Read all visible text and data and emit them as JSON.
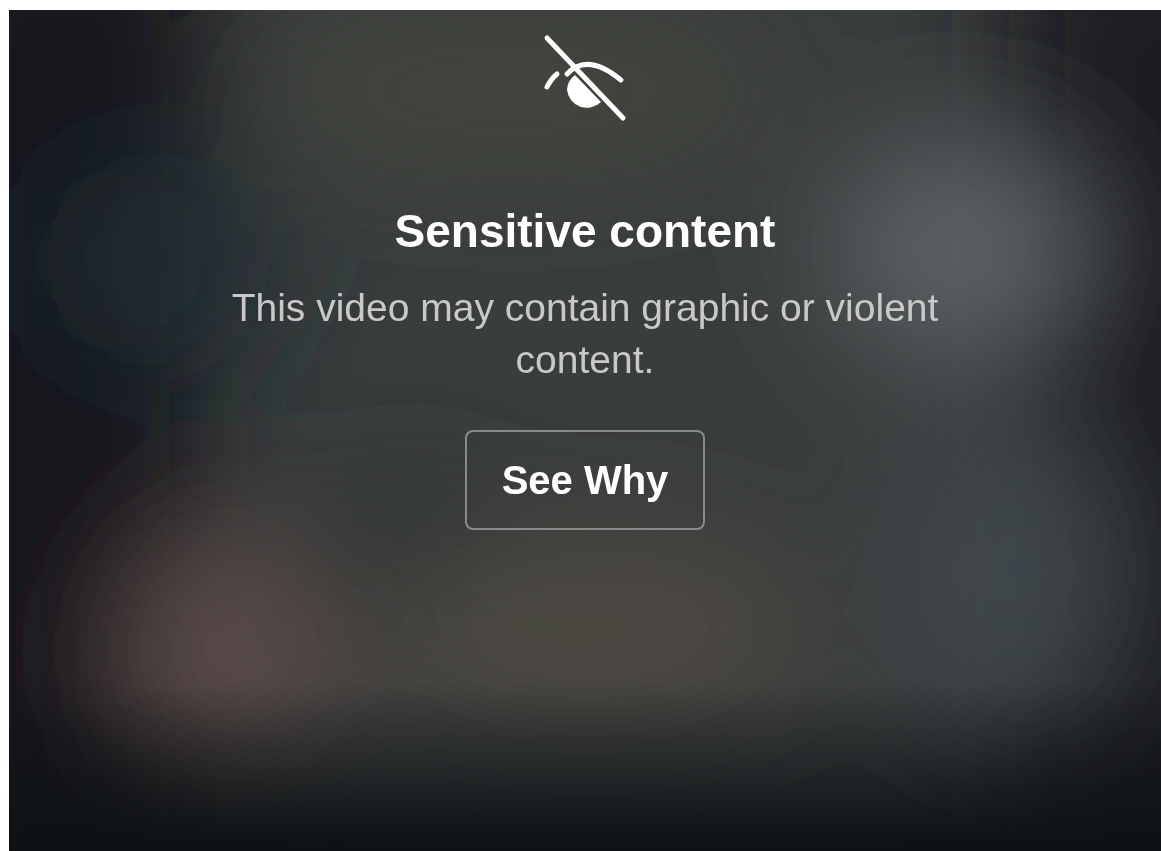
{
  "overlay": {
    "title": "Sensitive content",
    "message": "This video may contain graphic or violent content.",
    "button": "See Why"
  }
}
